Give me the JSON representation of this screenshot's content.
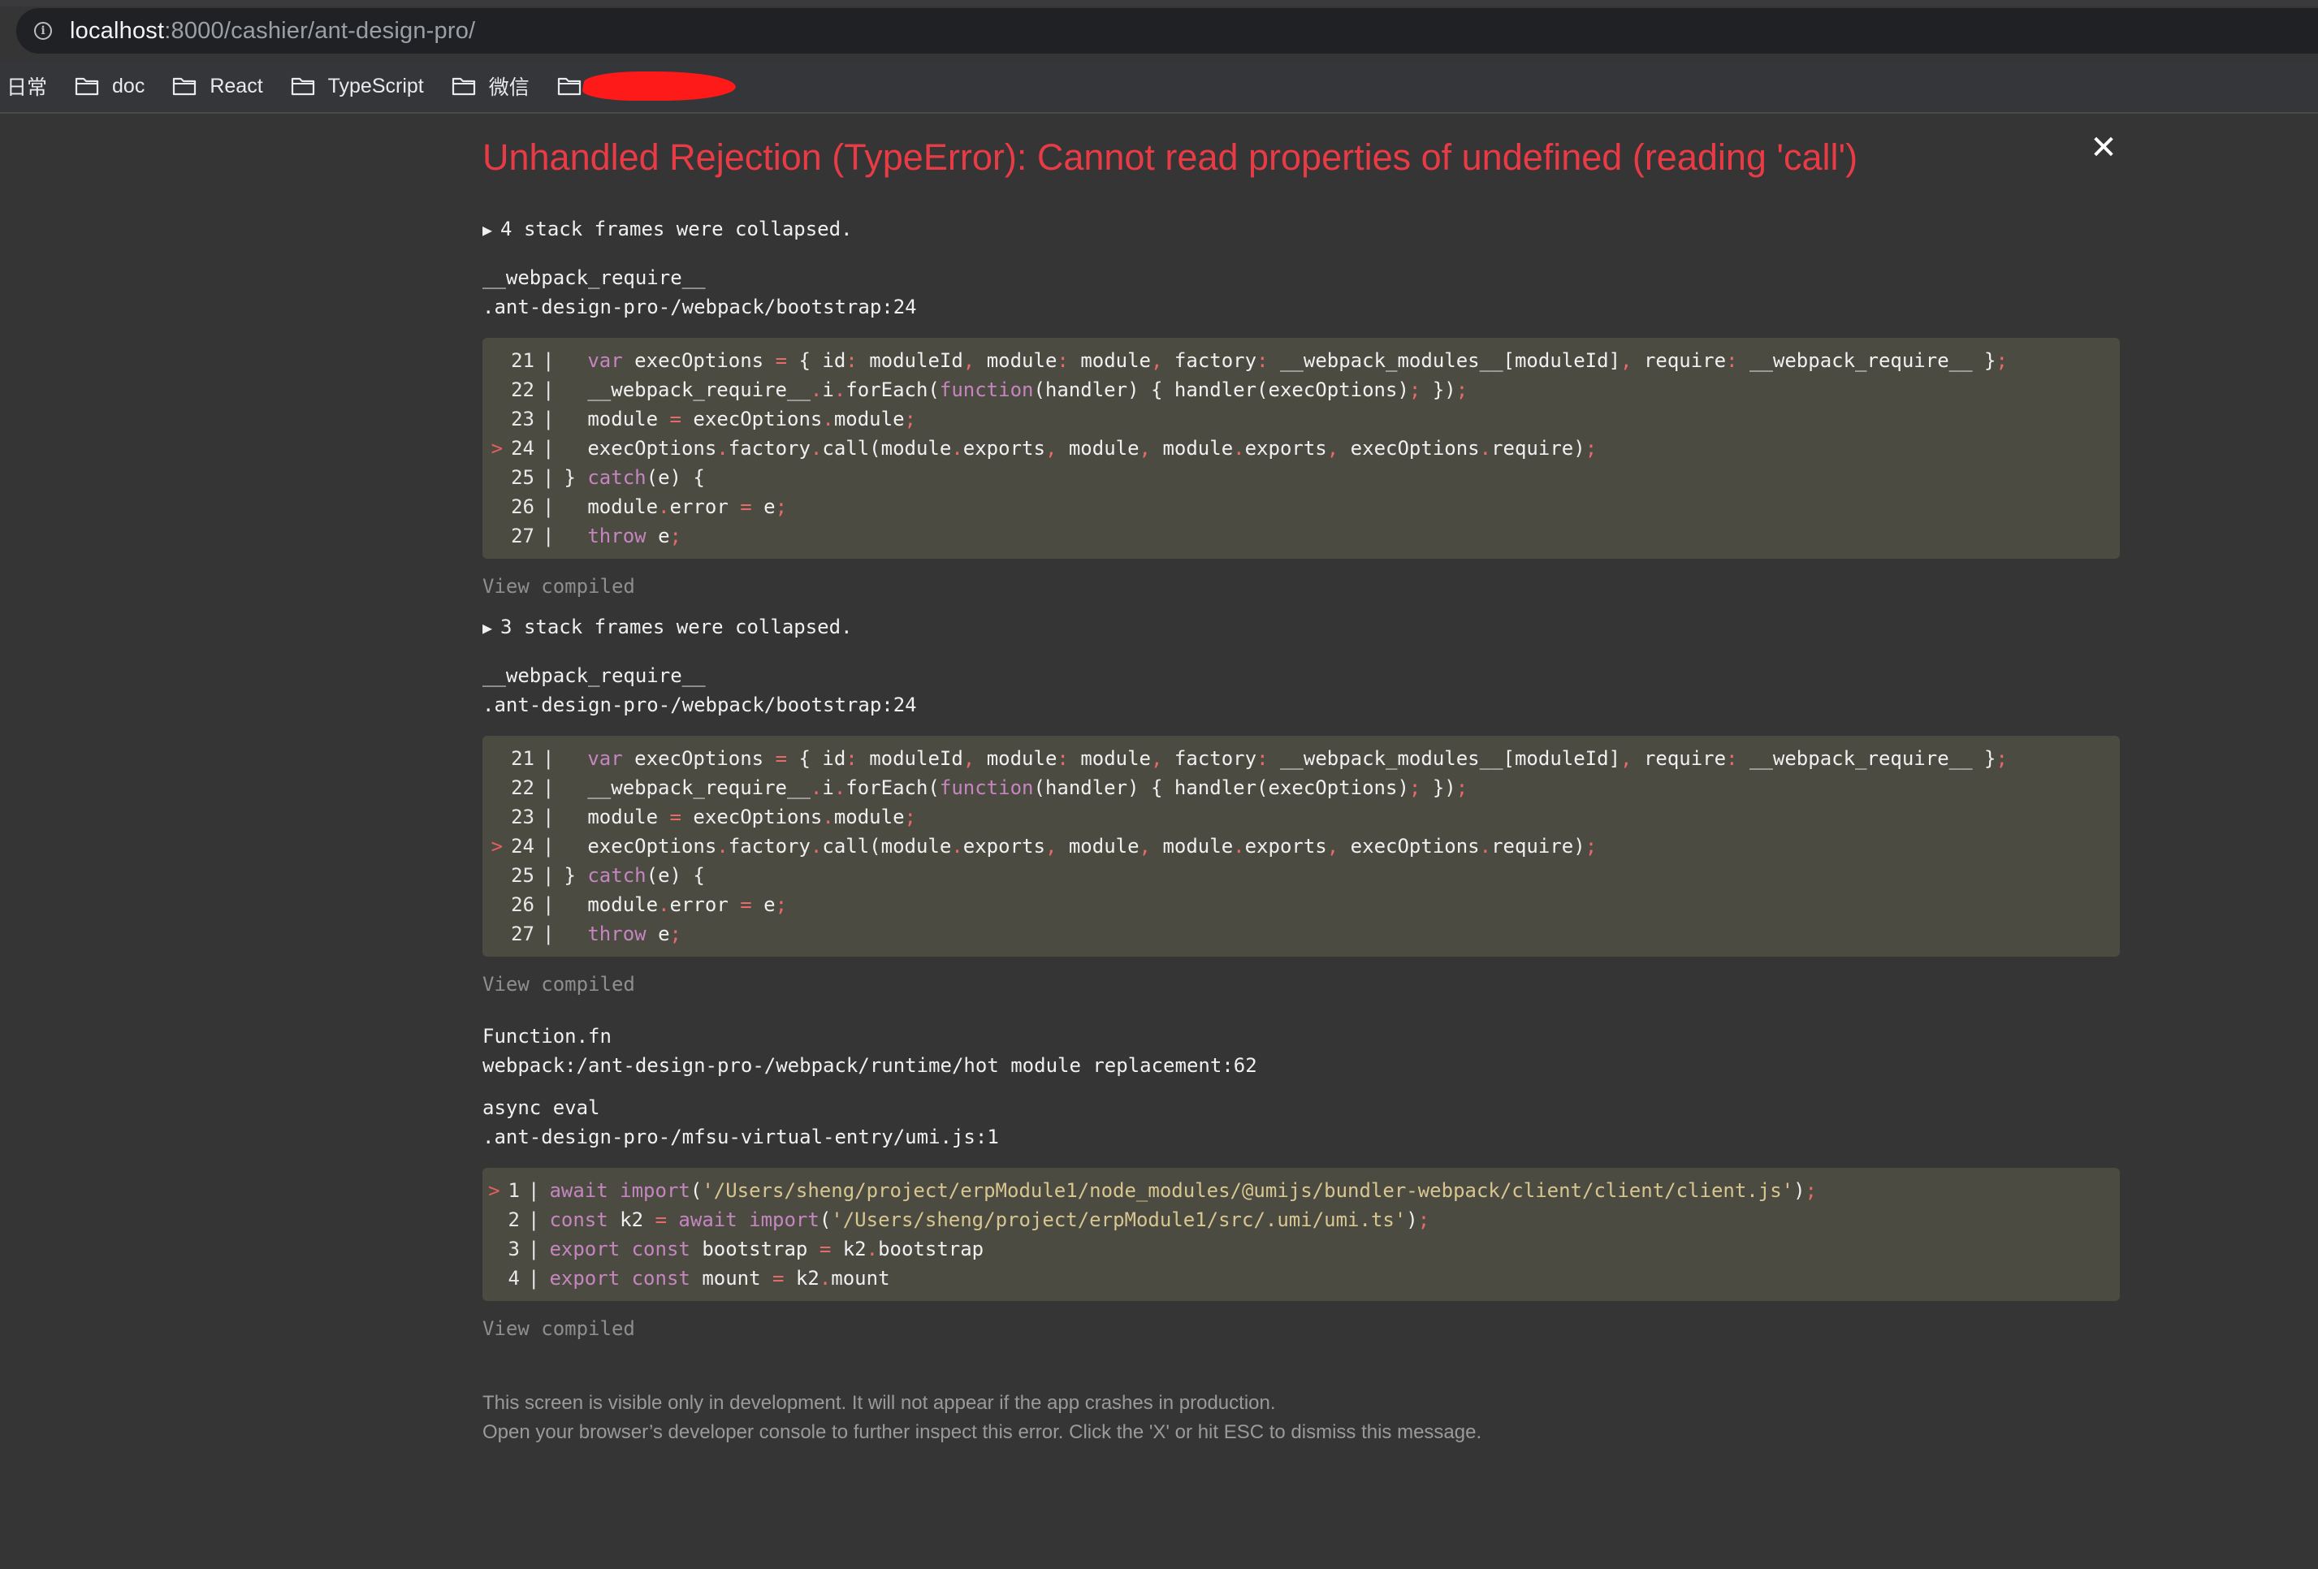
{
  "browser": {
    "url_host": "localhost",
    "url_path": ":8000/cashier/ant-design-pro/",
    "bookmarks": [
      {
        "label": "日常",
        "folder": false
      },
      {
        "label": "doc",
        "folder": true
      },
      {
        "label": "React",
        "folder": true
      },
      {
        "label": "TypeScript",
        "folder": true
      },
      {
        "label": "微信",
        "folder": true
      }
    ],
    "redaction_color": "#ff1a1a"
  },
  "error": {
    "title": "Unhandled Rejection (TypeError): Cannot read properties of undefined (reading 'call')",
    "title_color": "#e83b46",
    "close_label": "✕",
    "collapsed_1": "4 stack frames were collapsed.",
    "frame_1": {
      "name": "__webpack_require__",
      "location": ".ant-design-pro-/webpack/bootstrap:24"
    },
    "view_compiled_1": "View compiled",
    "collapsed_2": "3 stack frames were collapsed.",
    "frame_2": {
      "name": "__webpack_require__",
      "location": ".ant-design-pro-/webpack/bootstrap:24"
    },
    "view_compiled_2": "View compiled",
    "frame_3": {
      "name": "Function.fn",
      "location": "webpack:/ant-design-pro-/webpack/runtime/hot module replacement:62"
    },
    "frame_4": {
      "name": "async eval",
      "location": ".ant-design-pro-/mfsu-virtual-entry/umi.js:1"
    },
    "view_compiled_3": "View compiled",
    "footer_line_1": "This screen is visible only in development. It will not appear if the app crashes in production.",
    "footer_line_2": "Open your browser’s developer console to further inspect this error.  Click the 'X' or hit ESC to dismiss this message."
  },
  "code_a": [
    {
      "n": "21",
      "mark": false,
      "text": "  var execOptions = { id: moduleId, module: module, factory: __webpack_modules__[moduleId], require: __webpack_require__ };"
    },
    {
      "n": "22",
      "mark": false,
      "text": "  __webpack_require__.i.forEach(function(handler) { handler(execOptions); });"
    },
    {
      "n": "23",
      "mark": false,
      "text": "  module = execOptions.module;"
    },
    {
      "n": "24",
      "mark": true,
      "text": "  execOptions.factory.call(module.exports, module, module.exports, execOptions.require);"
    },
    {
      "n": "25",
      "mark": false,
      "text": "} catch(e) {"
    },
    {
      "n": "26",
      "mark": false,
      "text": "  module.error = e;"
    },
    {
      "n": "27",
      "mark": false,
      "text": "  throw e;"
    }
  ],
  "code_b": [
    {
      "n": "21",
      "mark": false,
      "text": "  var execOptions = { id: moduleId, module: module, factory: __webpack_modules__[moduleId], require: __webpack_require__ };"
    },
    {
      "n": "22",
      "mark": false,
      "text": "  __webpack_require__.i.forEach(function(handler) { handler(execOptions); });"
    },
    {
      "n": "23",
      "mark": false,
      "text": "  module = execOptions.module;"
    },
    {
      "n": "24",
      "mark": true,
      "text": "  execOptions.factory.call(module.exports, module, module.exports, execOptions.require);"
    },
    {
      "n": "25",
      "mark": false,
      "text": "} catch(e) {"
    },
    {
      "n": "26",
      "mark": false,
      "text": "  module.error = e;"
    },
    {
      "n": "27",
      "mark": false,
      "text": "  throw e;"
    }
  ],
  "code_c": [
    {
      "n": "1",
      "mark": true,
      "text": "await import('/Users/sheng/project/erpModule1/node_modules/@umijs/bundler-webpack/client/client/client.js');"
    },
    {
      "n": "2",
      "mark": false,
      "text": "const k2 = await import('/Users/sheng/project/erpModule1/src/.umi/umi.ts');"
    },
    {
      "n": "3",
      "mark": false,
      "text": "export const bootstrap = k2.bootstrap"
    },
    {
      "n": "4",
      "mark": false,
      "text": "export const mount = k2.mount"
    }
  ]
}
